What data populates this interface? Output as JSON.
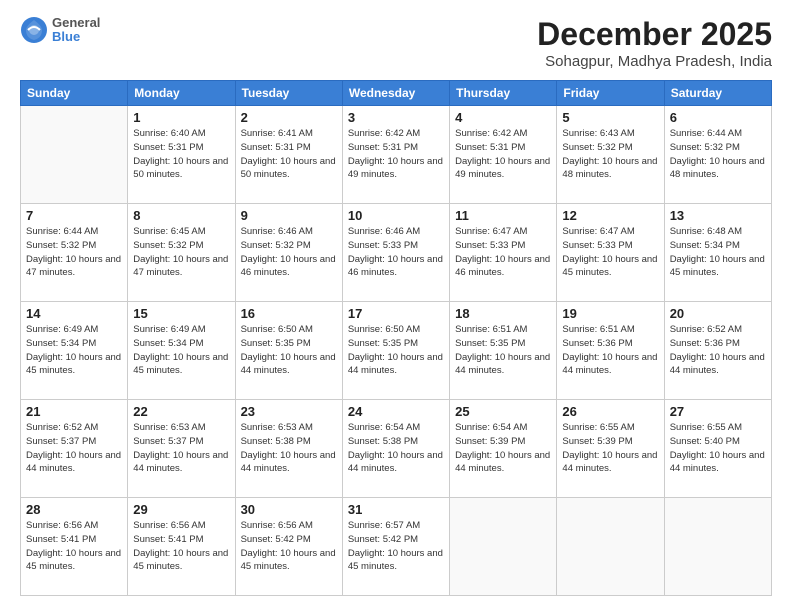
{
  "logo": {
    "general": "General",
    "blue": "Blue"
  },
  "header": {
    "month": "December 2025",
    "location": "Sohagpur, Madhya Pradesh, India"
  },
  "weekdays": [
    "Sunday",
    "Monday",
    "Tuesday",
    "Wednesday",
    "Thursday",
    "Friday",
    "Saturday"
  ],
  "weeks": [
    [
      {
        "day": null,
        "info": null
      },
      {
        "day": "1",
        "sunrise": "Sunrise: 6:40 AM",
        "sunset": "Sunset: 5:31 PM",
        "daylight": "Daylight: 10 hours and 50 minutes."
      },
      {
        "day": "2",
        "sunrise": "Sunrise: 6:41 AM",
        "sunset": "Sunset: 5:31 PM",
        "daylight": "Daylight: 10 hours and 50 minutes."
      },
      {
        "day": "3",
        "sunrise": "Sunrise: 6:42 AM",
        "sunset": "Sunset: 5:31 PM",
        "daylight": "Daylight: 10 hours and 49 minutes."
      },
      {
        "day": "4",
        "sunrise": "Sunrise: 6:42 AM",
        "sunset": "Sunset: 5:31 PM",
        "daylight": "Daylight: 10 hours and 49 minutes."
      },
      {
        "day": "5",
        "sunrise": "Sunrise: 6:43 AM",
        "sunset": "Sunset: 5:32 PM",
        "daylight": "Daylight: 10 hours and 48 minutes."
      },
      {
        "day": "6",
        "sunrise": "Sunrise: 6:44 AM",
        "sunset": "Sunset: 5:32 PM",
        "daylight": "Daylight: 10 hours and 48 minutes."
      }
    ],
    [
      {
        "day": "7",
        "sunrise": "Sunrise: 6:44 AM",
        "sunset": "Sunset: 5:32 PM",
        "daylight": "Daylight: 10 hours and 47 minutes."
      },
      {
        "day": "8",
        "sunrise": "Sunrise: 6:45 AM",
        "sunset": "Sunset: 5:32 PM",
        "daylight": "Daylight: 10 hours and 47 minutes."
      },
      {
        "day": "9",
        "sunrise": "Sunrise: 6:46 AM",
        "sunset": "Sunset: 5:32 PM",
        "daylight": "Daylight: 10 hours and 46 minutes."
      },
      {
        "day": "10",
        "sunrise": "Sunrise: 6:46 AM",
        "sunset": "Sunset: 5:33 PM",
        "daylight": "Daylight: 10 hours and 46 minutes."
      },
      {
        "day": "11",
        "sunrise": "Sunrise: 6:47 AM",
        "sunset": "Sunset: 5:33 PM",
        "daylight": "Daylight: 10 hours and 46 minutes."
      },
      {
        "day": "12",
        "sunrise": "Sunrise: 6:47 AM",
        "sunset": "Sunset: 5:33 PM",
        "daylight": "Daylight: 10 hours and 45 minutes."
      },
      {
        "day": "13",
        "sunrise": "Sunrise: 6:48 AM",
        "sunset": "Sunset: 5:34 PM",
        "daylight": "Daylight: 10 hours and 45 minutes."
      }
    ],
    [
      {
        "day": "14",
        "sunrise": "Sunrise: 6:49 AM",
        "sunset": "Sunset: 5:34 PM",
        "daylight": "Daylight: 10 hours and 45 minutes."
      },
      {
        "day": "15",
        "sunrise": "Sunrise: 6:49 AM",
        "sunset": "Sunset: 5:34 PM",
        "daylight": "Daylight: 10 hours and 45 minutes."
      },
      {
        "day": "16",
        "sunrise": "Sunrise: 6:50 AM",
        "sunset": "Sunset: 5:35 PM",
        "daylight": "Daylight: 10 hours and 44 minutes."
      },
      {
        "day": "17",
        "sunrise": "Sunrise: 6:50 AM",
        "sunset": "Sunset: 5:35 PM",
        "daylight": "Daylight: 10 hours and 44 minutes."
      },
      {
        "day": "18",
        "sunrise": "Sunrise: 6:51 AM",
        "sunset": "Sunset: 5:35 PM",
        "daylight": "Daylight: 10 hours and 44 minutes."
      },
      {
        "day": "19",
        "sunrise": "Sunrise: 6:51 AM",
        "sunset": "Sunset: 5:36 PM",
        "daylight": "Daylight: 10 hours and 44 minutes."
      },
      {
        "day": "20",
        "sunrise": "Sunrise: 6:52 AM",
        "sunset": "Sunset: 5:36 PM",
        "daylight": "Daylight: 10 hours and 44 minutes."
      }
    ],
    [
      {
        "day": "21",
        "sunrise": "Sunrise: 6:52 AM",
        "sunset": "Sunset: 5:37 PM",
        "daylight": "Daylight: 10 hours and 44 minutes."
      },
      {
        "day": "22",
        "sunrise": "Sunrise: 6:53 AM",
        "sunset": "Sunset: 5:37 PM",
        "daylight": "Daylight: 10 hours and 44 minutes."
      },
      {
        "day": "23",
        "sunrise": "Sunrise: 6:53 AM",
        "sunset": "Sunset: 5:38 PM",
        "daylight": "Daylight: 10 hours and 44 minutes."
      },
      {
        "day": "24",
        "sunrise": "Sunrise: 6:54 AM",
        "sunset": "Sunset: 5:38 PM",
        "daylight": "Daylight: 10 hours and 44 minutes."
      },
      {
        "day": "25",
        "sunrise": "Sunrise: 6:54 AM",
        "sunset": "Sunset: 5:39 PM",
        "daylight": "Daylight: 10 hours and 44 minutes."
      },
      {
        "day": "26",
        "sunrise": "Sunrise: 6:55 AM",
        "sunset": "Sunset: 5:39 PM",
        "daylight": "Daylight: 10 hours and 44 minutes."
      },
      {
        "day": "27",
        "sunrise": "Sunrise: 6:55 AM",
        "sunset": "Sunset: 5:40 PM",
        "daylight": "Daylight: 10 hours and 44 minutes."
      }
    ],
    [
      {
        "day": "28",
        "sunrise": "Sunrise: 6:56 AM",
        "sunset": "Sunset: 5:41 PM",
        "daylight": "Daylight: 10 hours and 45 minutes."
      },
      {
        "day": "29",
        "sunrise": "Sunrise: 6:56 AM",
        "sunset": "Sunset: 5:41 PM",
        "daylight": "Daylight: 10 hours and 45 minutes."
      },
      {
        "day": "30",
        "sunrise": "Sunrise: 6:56 AM",
        "sunset": "Sunset: 5:42 PM",
        "daylight": "Daylight: 10 hours and 45 minutes."
      },
      {
        "day": "31",
        "sunrise": "Sunrise: 6:57 AM",
        "sunset": "Sunset: 5:42 PM",
        "daylight": "Daylight: 10 hours and 45 minutes."
      },
      {
        "day": null,
        "info": null
      },
      {
        "day": null,
        "info": null
      },
      {
        "day": null,
        "info": null
      }
    ]
  ]
}
